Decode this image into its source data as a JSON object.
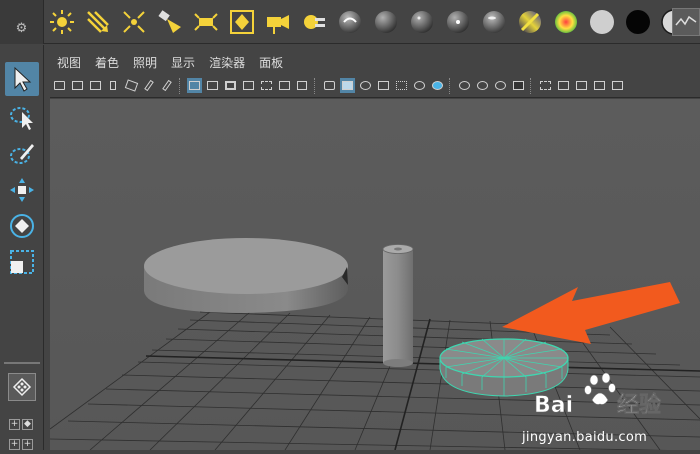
{
  "shelf": {
    "icons": [
      "sun-light-icon",
      "directional-light-icon",
      "point-light-icon",
      "spot-light-icon",
      "area-light-icon",
      "volume-light-icon",
      "camera-icon",
      "camera-aim-icon",
      "blinn-sphere-icon",
      "lambert-sphere-icon",
      "phong-sphere-icon",
      "phong-e-sphere-icon",
      "anisotropic-sphere-icon",
      "ramp-sphere-icon",
      "ocean-sphere-icon",
      "white-sphere-icon",
      "black-sphere-icon",
      "grey-sphere-icon",
      "hypergraph-icon"
    ]
  },
  "toolbox": {
    "tools": [
      "select-tool",
      "lasso-tool",
      "paint-select-tool",
      "move-tool",
      "rotate-tool",
      "scale-tool"
    ]
  },
  "panel_menu": {
    "items": [
      "视图",
      "着色",
      "照明",
      "显示",
      "渲染器",
      "面板"
    ]
  },
  "viewport": {
    "selection_color": "#3fd6b0",
    "arrow_color": "#f25a1e",
    "grid_color": "#262626"
  },
  "watermark": {
    "logo": "Bai 经验",
    "url": "jingyan.baidu.com"
  }
}
